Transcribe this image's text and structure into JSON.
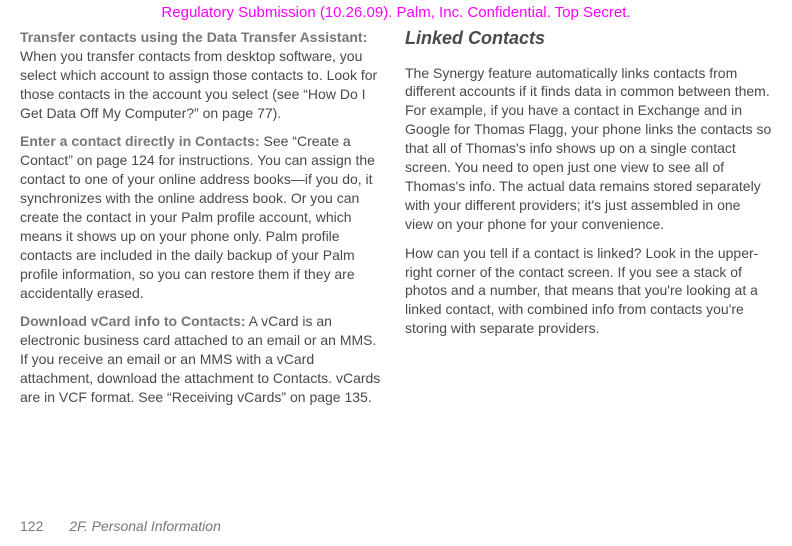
{
  "banner": "Regulatory Submission (10.26.09). Palm, Inc. Confidential. Top Secret.",
  "left": {
    "p1_lead": "Transfer contacts using the Data Transfer Assistant:",
    "p1": " When you transfer contacts from desktop software, you select which account to assign those contacts to. Look for those contacts in the account you select (see “How Do I Get Data Off My Computer?” on page 77).",
    "p2_lead": "Enter a contact directly in Contacts:",
    "p2": " See “Create a Contact” on page 124 for instructions. You can assign the contact to one of your online address books—if you do, it synchronizes with the online address book. Or you can create the contact in your Palm profile account, which means it shows up on your phone only. Palm profile contacts are included in the daily backup of your Palm profile information, so you can restore them if they are accidentally erased.",
    "p3_lead": "Download vCard info to Contacts:",
    "p3": " A vCard is an electronic business card attached to an email or an MMS. If you receive an email or an MMS with a vCard attachment, download the attachment to Contacts. vCards are in VCF format. See “Receiving vCards” on page 135."
  },
  "right": {
    "heading": "Linked Contacts",
    "p1": "The Synergy feature automatically links contacts from different accounts if it finds data in common between them. For example, if you have a contact in Exchange and in Google for Thomas Flagg, your phone links the contacts so that all of Thomas's info shows up on a single contact screen. You need to open just one view to see all of Thomas's info. The actual data remains stored separately with your different providers; it's just assembled in one view on your phone for your convenience.",
    "p2": "How can you tell if a contact is linked? Look in the upper-right corner of the contact screen. If you see a stack of photos and a number, that means that you're looking at a linked contact, with combined info from contacts you're storing with separate providers."
  },
  "footer": {
    "page_number": "122",
    "section": "2F. Personal Information"
  }
}
